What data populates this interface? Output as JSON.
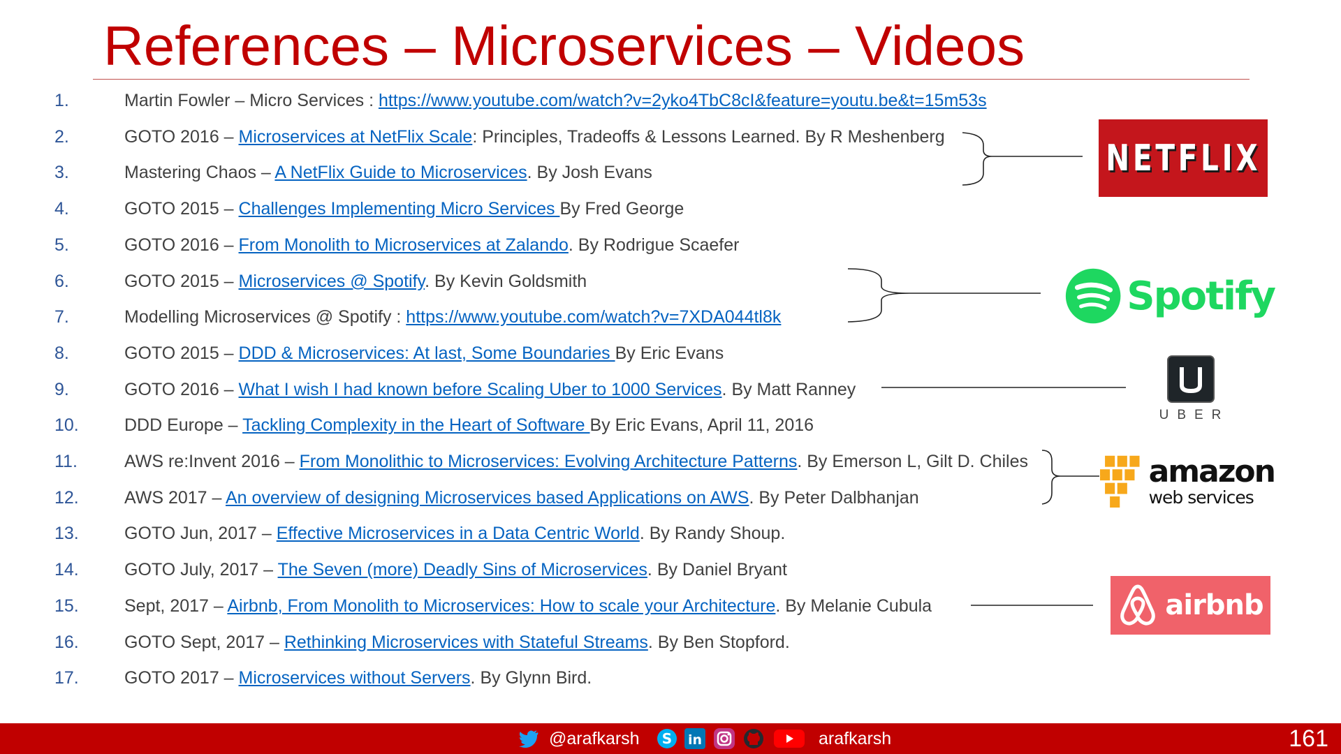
{
  "slide": {
    "title": "References – Microservices – Videos",
    "page_number": "161"
  },
  "references": [
    {
      "num": "1.",
      "pre": "Martin Fowler – Micro Services : ",
      "link": "https://www.youtube.com/watch?v=2yko4TbC8cI&feature=youtu.be&t=15m53s",
      "post": ""
    },
    {
      "num": "2.",
      "pre": "GOTO 2016 – ",
      "link": "Microservices at NetFlix Scale",
      "post": ": Principles, Tradeoffs &  Lessons Learned. By R Meshenberg"
    },
    {
      "num": "3.",
      "pre": "Mastering Chaos – ",
      "link": "A NetFlix Guide to Microservices",
      "post": ". By Josh Evans"
    },
    {
      "num": "4.",
      "pre": "GOTO 2015 – ",
      "link": "Challenges Implementing Micro Services ",
      "post": "By Fred George"
    },
    {
      "num": "5.",
      "pre": "GOTO 2016 – ",
      "link": "From Monolith to Microservices at Zalando",
      "post": ". By Rodrigue Scaefer"
    },
    {
      "num": "6.",
      "pre": "GOTO 2015 – ",
      "link": "Microservices @ Spotify",
      "post": ". By Kevin Goldsmith"
    },
    {
      "num": "7.",
      "pre": "Modelling Microservices @ Spotify : ",
      "link": "https://www.youtube.com/watch?v=7XDA044tl8k",
      "post": ""
    },
    {
      "num": "8.",
      "pre": "GOTO 2015 – ",
      "link": "DDD & Microservices: At last, Some Boundaries ",
      "post": "By Eric Evans"
    },
    {
      "num": "9.",
      "pre": "GOTO 2016 – ",
      "link": "What I wish I had known before Scaling Uber to 1000 Services",
      "post": ".  By Matt Ranney"
    },
    {
      "num": "10.",
      "pre": "DDD Europe – ",
      "link": "Tackling Complexity in the Heart of Software ",
      "post": "By Eric Evans, April 11, 2016"
    },
    {
      "num": "11.",
      "pre": "AWS re:Invent 2016 – ",
      "link": "From Monolithic to Microservices: Evolving Architecture Patterns",
      "post": ". By Emerson L, Gilt D. Chiles"
    },
    {
      "num": "12.",
      "pre": "AWS 2017 – ",
      "link": "An overview of designing Microservices based Applications on AWS",
      "post": ". By Peter Dalbhanjan"
    },
    {
      "num": "13.",
      "pre": "GOTO Jun, 2017 – ",
      "link": "Effective Microservices in a Data Centric World",
      "post": ". By Randy Shoup."
    },
    {
      "num": "14.",
      "pre": "GOTO July, 2017 – ",
      "link": "The Seven (more)  Deadly Sins of Microservices",
      "post": ". By Daniel Bryant"
    },
    {
      "num": "15.",
      "pre": "Sept, 2017 – ",
      "link": "Airbnb, From Monolith to Microservices: How to scale your Architecture",
      "post": ". By Melanie Cubula"
    },
    {
      "num": "16.",
      "pre": "GOTO Sept, 2017 – ",
      "link": "Rethinking Microservices with Stateful Streams",
      "post": ". By Ben Stopford."
    },
    {
      "num": "17.",
      "pre": "GOTO 2017 – ",
      "link": "Microservices without Servers",
      "post": ".  By Glynn Bird."
    }
  ],
  "logos": {
    "netflix": "NETFLIX",
    "spotify": "Spotify",
    "uber": "UBER",
    "aws_line1": "amazon",
    "aws_line2": "web services",
    "airbnb": "airbnb"
  },
  "footer": {
    "twitter_handle": "@arafkarsh",
    "youtube_handle": "arafkarsh",
    "icons": [
      "twitter-icon",
      "skype-icon",
      "linkedin-icon",
      "instagram-icon",
      "github-icon",
      "youtube-icon"
    ]
  },
  "colors": {
    "title": "#c00000",
    "footer_bg": "#c00000",
    "link": "#0563c1",
    "number": "#2e5597",
    "text": "#404040"
  }
}
